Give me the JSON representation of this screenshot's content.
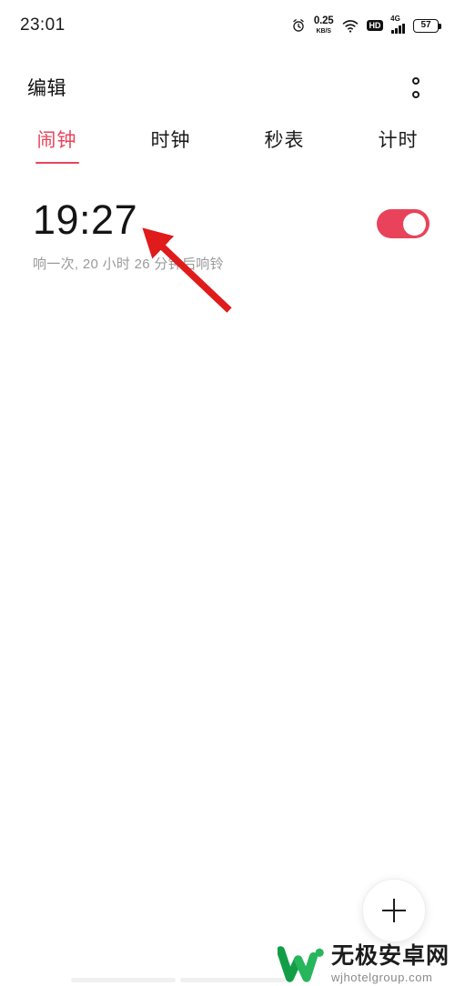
{
  "statusbar": {
    "time": "23:01",
    "alarm_icon": "alarm-clock-icon",
    "netspeed_value": "0.25",
    "netspeed_unit": "KB/S",
    "wifi_icon": "wifi-icon",
    "hd_label": "HD",
    "network_type": "4G",
    "signal_icon": "signal-bars-icon",
    "battery_level": "57"
  },
  "appbar": {
    "title": "编辑",
    "menu_icon": "more-options-icon"
  },
  "tabs": [
    {
      "label": "闹钟",
      "active": true
    },
    {
      "label": "时钟",
      "active": false
    },
    {
      "label": "秒表",
      "active": false
    },
    {
      "label": "计时",
      "active": false
    }
  ],
  "alarms": [
    {
      "time": "19:27",
      "subtitle": "响一次, 20 小时 26 分钟后响铃",
      "enabled": true
    }
  ],
  "fab": {
    "icon": "plus-icon",
    "label": "+"
  },
  "annotation": {
    "type": "arrow",
    "color": "#E01B1B",
    "points_to": "alarm-time"
  },
  "watermark": {
    "site_cn": "无极安卓网",
    "site_en": "wjhotelgroup.com",
    "logo": "w-logo-icon"
  },
  "colors": {
    "accent": "#E8455C",
    "toggle_on": "#E8435A",
    "text_primary": "#141414",
    "text_secondary": "#9a9a9a",
    "background": "#ffffff",
    "annotation_red": "#E01B1B",
    "logo_green": "#1BA84C"
  }
}
